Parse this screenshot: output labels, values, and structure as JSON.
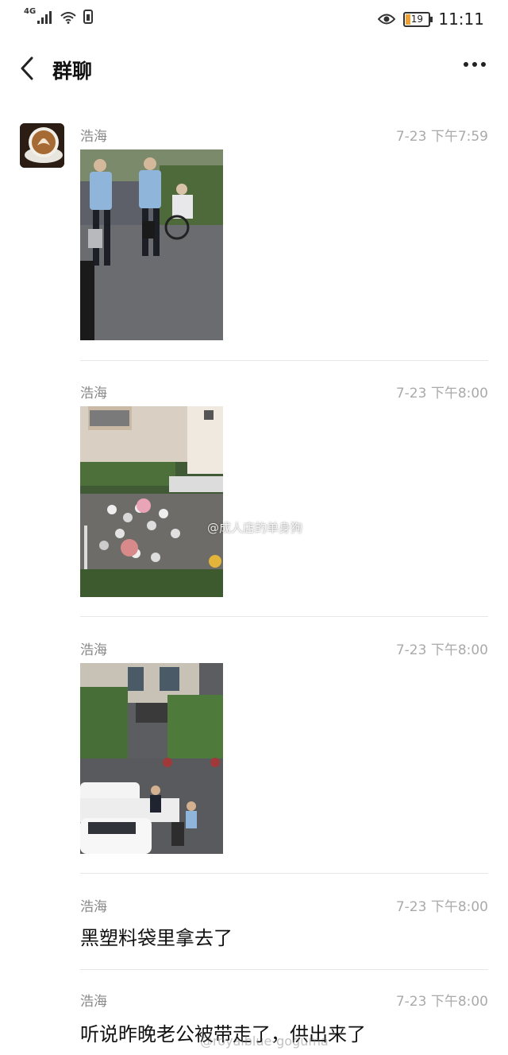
{
  "status_bar": {
    "network": "4G",
    "battery": "19",
    "time": "11:11",
    "icons": [
      "signal-icon",
      "wifi-icon",
      "sim-icon",
      "eye-icon",
      "battery-icon"
    ]
  },
  "header": {
    "title": "群聊",
    "icons": [
      "back-arrow-icon",
      "more-icon"
    ]
  },
  "messages": [
    {
      "sender": "浩海",
      "time": "7-23 下午7:59",
      "type": "image",
      "image": "police-officers-walking-photo"
    },
    {
      "sender": "浩海",
      "time": "7-23 下午8:00",
      "type": "image",
      "image": "crowd-outside-building-photo",
      "watermark": "@成人店的单身狗"
    },
    {
      "sender": "浩海",
      "time": "7-23 下午8:00",
      "type": "image",
      "image": "police-cars-street-photo"
    },
    {
      "sender": "浩海",
      "time": "7-23 下午8:00",
      "type": "text",
      "text": "黑塑料袋里拿去了"
    },
    {
      "sender": "浩海",
      "time": "7-23 下午8:00",
      "type": "text",
      "text": "听说昨晚老公被带走了，供出来了"
    }
  ],
  "page_watermark": "@royalblue-goguma",
  "colors": {
    "background": "#ffffff",
    "meta_text": "#aaaaaa",
    "divider": "#e6e6e6"
  }
}
